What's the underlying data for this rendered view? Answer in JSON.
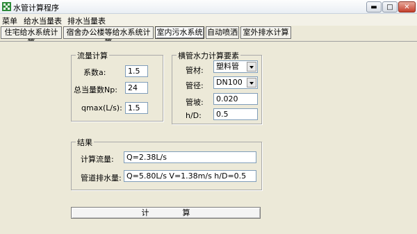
{
  "window": {
    "title": "水管计算程序",
    "minimize_icon": "minimize-icon",
    "maximize_icon": "maximize-icon",
    "close_icon": "close-icon"
  },
  "menu": [
    "菜单",
    "给水当量表",
    "排水当量表"
  ],
  "tabs": [
    "住宅给水系统计算",
    "宿舍办公楼等给水系统计算",
    "室内污水系统",
    "自动喷洒",
    "室外排水计算"
  ],
  "active_tab": "室内污水系统",
  "flow": {
    "title": "流量计算",
    "coef_label": "系数a:",
    "coef_value": "1.5",
    "np_label": "总当量数Np:",
    "np_value": "24",
    "qmax_label": "qmax(L/s):",
    "qmax_value": "1.5"
  },
  "pipe": {
    "title": "横管水力计算要素",
    "material_label": "管材:",
    "material_value": "塑料管",
    "diameter_label": "管径:",
    "diameter_value": "DN100",
    "slope_label": "管坡:",
    "slope_value": "0.020",
    "hd_label": "h/D:",
    "hd_value": "0.5"
  },
  "result": {
    "title": "结果",
    "flow_label": "计算流量:",
    "flow_value": "Q=2.38L/s",
    "drain_label": "管道排水量:",
    "drain_value": "Q=5.80L/s  V=1.38m/s  h/D=0.5"
  },
  "calc_button": "计算"
}
